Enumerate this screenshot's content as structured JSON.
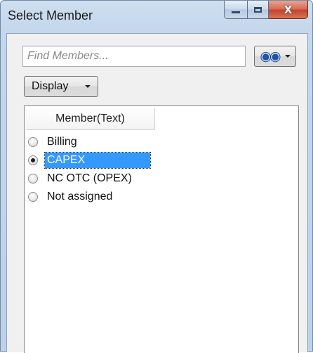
{
  "window": {
    "title": "Select Member",
    "caption": {
      "minimize_icon": "minimize-icon",
      "maximize_icon": "maximize-icon",
      "close_glyph": "X"
    }
  },
  "search": {
    "placeholder": "Find Members...",
    "value": "",
    "find_icon": "binoculars-icon"
  },
  "display_button": {
    "label": "Display"
  },
  "member_list": {
    "column_header": "Member(Text)",
    "items": [
      {
        "label": "Billing",
        "checked": false,
        "selected": false
      },
      {
        "label": "CAPEX",
        "checked": true,
        "selected": true
      },
      {
        "label": "NC OTC (OPEX)",
        "checked": false,
        "selected": false
      },
      {
        "label": "Not assigned",
        "checked": false,
        "selected": false
      }
    ]
  },
  "colors": {
    "selection": "#3399ff",
    "close_button": "#c2432a",
    "title_bar": "#c4d7ec"
  }
}
